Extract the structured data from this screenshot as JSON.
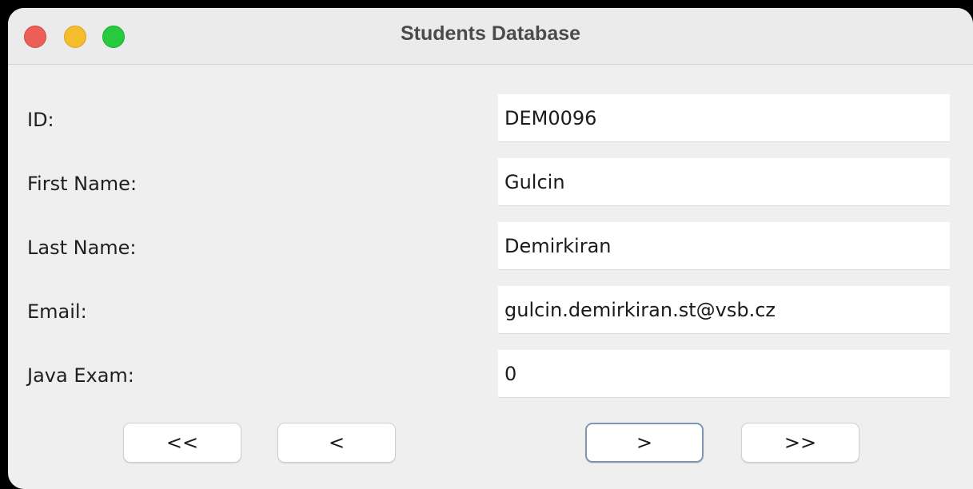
{
  "window": {
    "title": "Students Database"
  },
  "fields": [
    {
      "label": "ID:",
      "value": "DEM0096"
    },
    {
      "label": "First Name:",
      "value": "Gulcin"
    },
    {
      "label": "Last Name:",
      "value": "Demirkiran"
    },
    {
      "label": "Email:",
      "value": "gulcin.demirkiran.st@vsb.cz"
    },
    {
      "label": "Java Exam:",
      "value": "0"
    }
  ],
  "navigation": {
    "first_label": "<<",
    "previous_label": "<",
    "next_label": ">",
    "last_label": ">>"
  },
  "colors": {
    "close": "#ec5f57",
    "minimize": "#f5bd2e",
    "zoom": "#27c93f",
    "focus_ring": "#7e96b4"
  }
}
